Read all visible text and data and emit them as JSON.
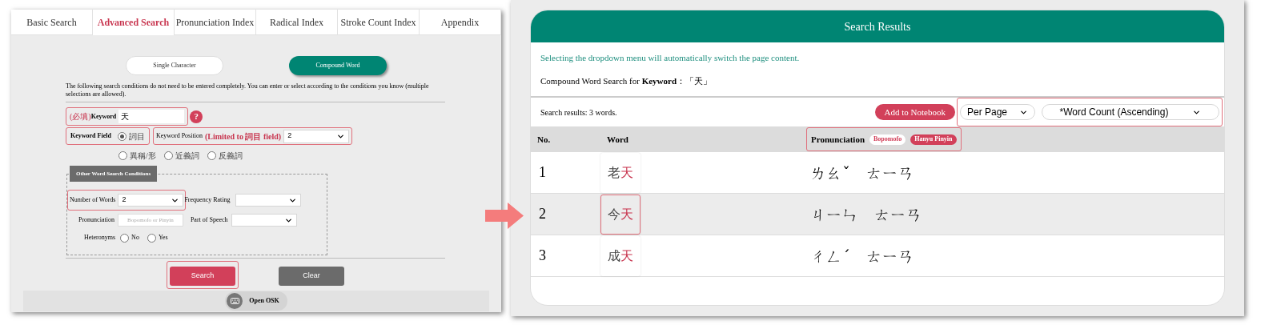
{
  "left": {
    "tabs": [
      {
        "label": "Basic Search",
        "selected": false
      },
      {
        "label": "Advanced Search",
        "selected": true
      },
      {
        "label": "Pronunciation Index",
        "selected": false
      },
      {
        "label": "Radical Index",
        "selected": false
      },
      {
        "label": "Stroke Count Index",
        "selected": false
      },
      {
        "label": "Appendix",
        "selected": false
      }
    ],
    "modes": [
      {
        "label": "Single Character",
        "selected": false
      },
      {
        "label": "Compound Word",
        "selected": true
      }
    ],
    "note": "The following search conditions do not need to be entered completely. You can enter or select according to the conditions you know (multiple selections are allowed).",
    "keyword": {
      "required": "(必填)",
      "label": "Keyword",
      "value": "天",
      "help": "?",
      "highlighted": true
    },
    "keyword_field": {
      "label": "Keyword Field",
      "option": {
        "label": "詞目",
        "selected": true
      },
      "highlighted": true
    },
    "keyword_position": {
      "label": "Keyword Position",
      "qualifier": "(Limited to 詞目 field)",
      "value": "2",
      "highlighted": true
    },
    "relation_options": [
      {
        "label": "異稱/形",
        "selected": false
      },
      {
        "label": "近義詞",
        "selected": false
      },
      {
        "label": "反義詞",
        "selected": false
      }
    ],
    "other_conditions": {
      "legend": "Other Word Search Conditions",
      "number_of_words": {
        "label": "Number of Words",
        "value": "2",
        "highlighted": true
      },
      "frequency_rating": {
        "label": "Frequency Rating"
      },
      "pronunciation": {
        "label": "Pronunciation",
        "placeholder": "Bopomofo or Pinyin"
      },
      "part_of_speech": {
        "label": "Part of Speech"
      },
      "heteronyms": {
        "label": "Heteronyms",
        "options": [
          {
            "label": "No",
            "selected": false
          },
          {
            "label": "Yes",
            "selected": false
          }
        ]
      }
    },
    "buttons": [
      {
        "label": "Search",
        "kind": "primary",
        "highlighted": true
      },
      {
        "label": "Clear",
        "kind": "secondary",
        "highlighted": false
      }
    ],
    "osk": {
      "label": "Open OSK"
    }
  },
  "right": {
    "title": "Search Results",
    "hint": "Selecting the dropdown menu will automatically switch the page content.",
    "query": "Compound Word Search for **Keyword**：「天」",
    "count": "Search results: 3 words.",
    "notebook_button": "Add to Notebook",
    "selects": {
      "per_page": "Per Page",
      "sort": "*Word Count (Ascending)",
      "highlighted": true
    },
    "columns": {
      "no": "No.",
      "word": "Word",
      "pronunciation": "Pronunciation"
    },
    "pronunciation_modes": [
      {
        "label": "Bopomofo",
        "selected": false
      },
      {
        "label": "Hanyu Pinyin",
        "selected": true
      }
    ],
    "pronunciation_highlighted": true,
    "rows": [
      {
        "no": "1",
        "chars": [
          {
            "text": "老",
            "keyword": false
          },
          {
            "text": "天",
            "keyword": true
          }
        ],
        "pronunciation": "ㄌㄠˇ　ㄊㄧㄢ",
        "highlighted": false
      },
      {
        "no": "2",
        "chars": [
          {
            "text": "今",
            "keyword": false
          },
          {
            "text": "天",
            "keyword": true
          }
        ],
        "pronunciation": "ㄐㄧㄣ　ㄊㄧㄢ",
        "highlighted": true
      },
      {
        "no": "3",
        "chars": [
          {
            "text": "成",
            "keyword": false
          },
          {
            "text": "天",
            "keyword": true
          }
        ],
        "pronunciation": "ㄔㄥˊ　ㄊㄧㄢ",
        "highlighted": false
      }
    ]
  }
}
